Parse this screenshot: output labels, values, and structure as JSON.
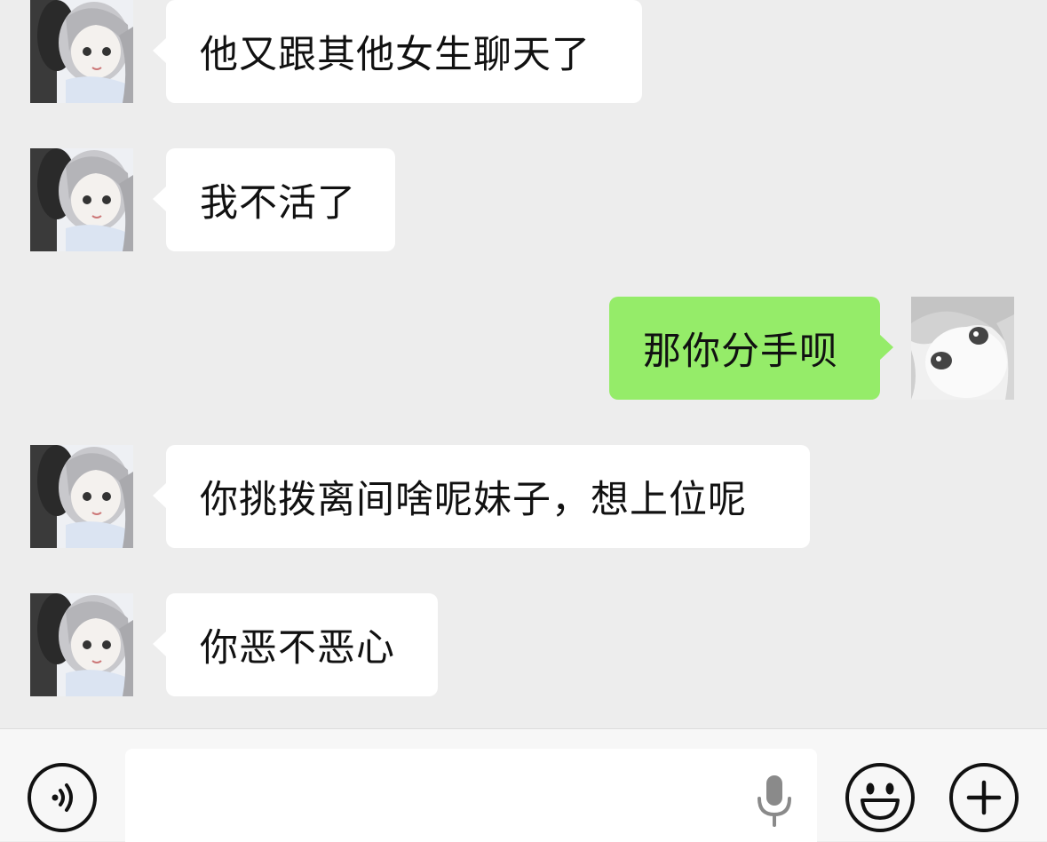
{
  "messages": [
    {
      "side": "in",
      "text": "他又跟其他女生聊天了"
    },
    {
      "side": "in",
      "text": "我不活了"
    },
    {
      "side": "out",
      "text": "那你分手呗"
    },
    {
      "side": "in",
      "text": "你挑拨离间啥呢妹子，想上位呢"
    },
    {
      "side": "in",
      "text": "你恶不恶心"
    }
  ],
  "colors": {
    "background": "#ededed",
    "incoming_bubble": "#ffffff",
    "outgoing_bubble": "#95ec69",
    "input_bar": "#f7f7f7"
  },
  "input_bar": {
    "voice_icon": "voice-toggle-icon",
    "mic_icon": "microphone-icon",
    "emoji_icon": "emoji-icon",
    "plus_icon": "plus-icon",
    "text_value": ""
  }
}
